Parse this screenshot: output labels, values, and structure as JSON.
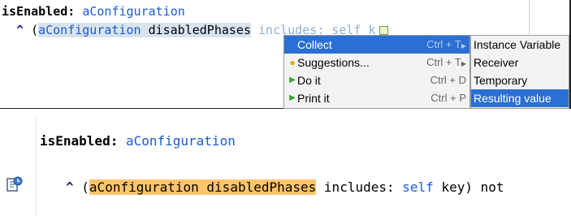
{
  "top": {
    "line1": {
      "selector": "isEnabled:",
      "arg": "aConfiguration"
    },
    "line2": {
      "caret": "^",
      "open_paren": "(",
      "receiver": "aConfiguration",
      "message": "disabledPhases",
      "peek": "includes: self k"
    }
  },
  "context_menu": {
    "items": [
      {
        "label": "Collect",
        "shortcut": "Ctrl + T",
        "icon": "",
        "has_submenu": true,
        "selected": true
      },
      {
        "label": "Suggestions...",
        "shortcut": "Ctrl + T",
        "icon": "lightbulb-icon",
        "has_submenu": true,
        "selected": false
      },
      {
        "label": "Do it",
        "shortcut": "Ctrl + D",
        "icon": "play-icon",
        "has_submenu": false,
        "selected": false
      },
      {
        "label": "Print it",
        "shortcut": "Ctrl + P",
        "icon": "play-icon",
        "has_submenu": false,
        "selected": false
      }
    ]
  },
  "submenu": {
    "items": [
      {
        "label": "Instance Variable",
        "selected": false
      },
      {
        "label": "Receiver",
        "selected": false
      },
      {
        "label": "Temporary",
        "selected": false
      },
      {
        "label": "Resulting value",
        "selected": true
      }
    ]
  },
  "bottom": {
    "line1": {
      "selector": "isEnabled:",
      "arg": "aConfiguration"
    },
    "line2": {
      "caret": "^",
      "open_paren": "(",
      "highlighted": "aConfiguration disabledPhases",
      "message": "includes:",
      "self": "self",
      "rest": "key) not"
    }
  },
  "colors": {
    "selection": "#2b6fd4",
    "highlight": "#ffc56b",
    "argument": "#1a5bd0"
  }
}
